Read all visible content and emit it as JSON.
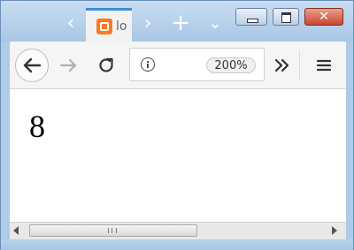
{
  "window": {
    "tab": {
      "title": "lo",
      "favicon": "xampp-favicon-icon"
    },
    "caption_buttons": [
      "minimize",
      "maximize",
      "close"
    ]
  },
  "toolbar": {
    "url_bar": {
      "zoom_level": "200%"
    }
  },
  "content": {
    "text": "8"
  },
  "colors": {
    "tab_accent": "#3b8ed8",
    "favicon": "#fb7a24",
    "close_button": "#c9452f"
  }
}
